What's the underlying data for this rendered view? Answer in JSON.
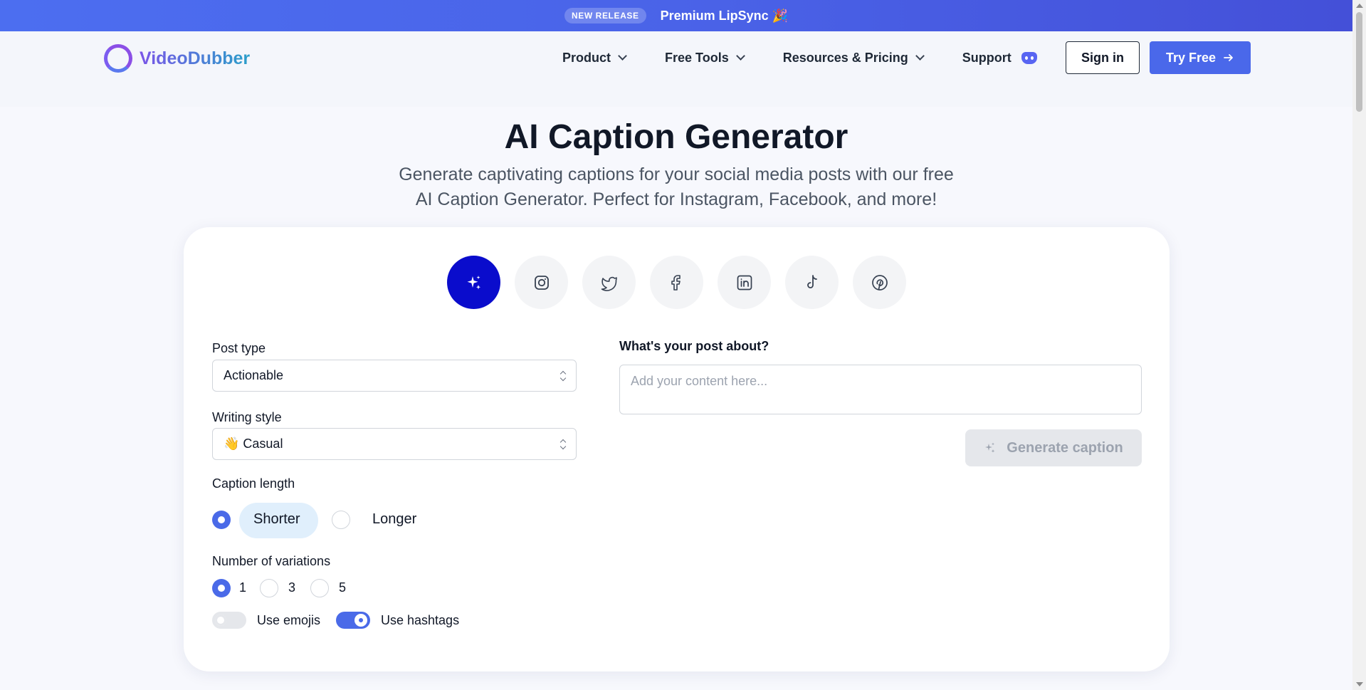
{
  "announcement": {
    "badge": "NEW RELEASE",
    "message": "Premium LipSync 🎉"
  },
  "header": {
    "logo_text": "VideoDubber",
    "nav": [
      {
        "label": "Product"
      },
      {
        "label": "Free Tools"
      },
      {
        "label": "Resources & Pricing"
      }
    ],
    "support_label": "Support",
    "signin_label": "Sign in",
    "try_label": "Try Free"
  },
  "hero": {
    "title": "AI Caption Generator",
    "subtitle_line1": "Generate captivating captions for your social media posts with our free",
    "subtitle_line2": "AI Caption Generator. Perfect for Instagram, Facebook, and more!"
  },
  "platforms": [
    "sparkles-icon",
    "instagram-icon",
    "twitter-icon",
    "facebook-icon",
    "linkedin-icon",
    "tiktok-icon",
    "pinterest-icon"
  ],
  "form": {
    "post_type_label": "Post type",
    "post_type_value": "Actionable",
    "writing_style_label": "Writing style",
    "writing_style_value": "👋 Casual",
    "caption_length_label": "Caption length",
    "length_options": [
      "Shorter",
      "Longer"
    ],
    "length_selected": "Shorter",
    "variations_label": "Number of variations",
    "variations_options": [
      "1",
      "3",
      "5"
    ],
    "variations_selected": "1",
    "emojis_label": "Use emojis",
    "emojis_on": false,
    "hashtags_label": "Use hashtags",
    "hashtags_on": true,
    "post_about_label": "What's your post about?",
    "post_about_placeholder": "Add your content here...",
    "generate_label": "Generate caption"
  },
  "colors": {
    "accent": "#4a6ae8",
    "active_platform": "#0a0ccc",
    "banner": "#4a63e8"
  }
}
